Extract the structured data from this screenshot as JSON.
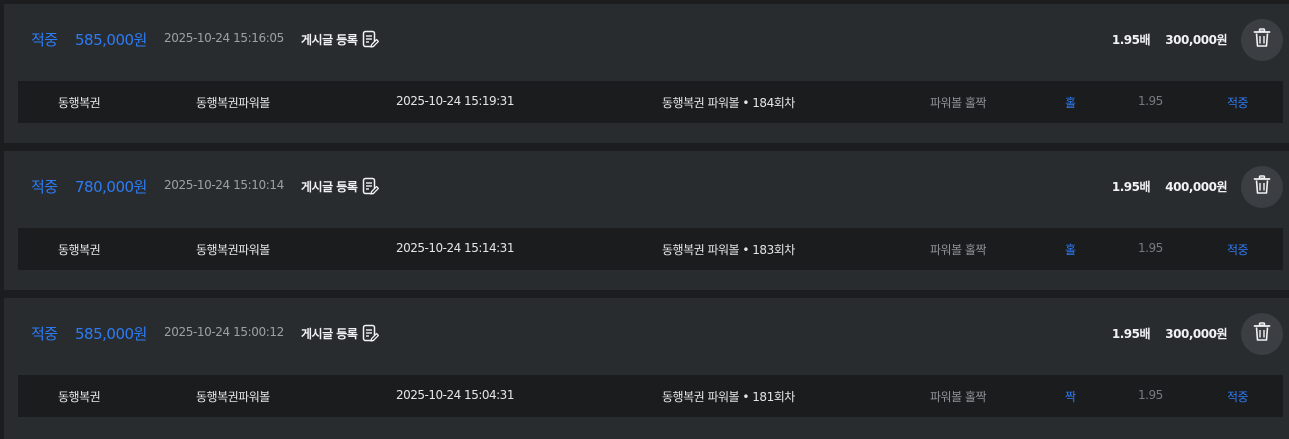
{
  "labels": {
    "post_button": "게시글 등록",
    "delete_icon": "trash-icon",
    "post_icon": "edit-note-icon"
  },
  "colors": {
    "accent": "#2d7bf4",
    "card_bg": "#292c2f",
    "row_bg": "#1b1c1e",
    "page_bg": "#1c1d1f"
  },
  "bets": [
    {
      "status": "적중",
      "win_amount": "585,000원",
      "bet_time": "2025-10-24 15:16:05",
      "total_odds": "1.95배",
      "bet_amount": "300,000원",
      "detail": {
        "company": "동행복권",
        "game": "동행복권파워볼",
        "draw_time": "2025-10-24 15:19:31",
        "round": "동행복권 파워볼 • 184회차",
        "market": "파워볼 홀짝",
        "pick": "홀",
        "odds": "1.95",
        "result": "적중"
      }
    },
    {
      "status": "적중",
      "win_amount": "780,000원",
      "bet_time": "2025-10-24 15:10:14",
      "total_odds": "1.95배",
      "bet_amount": "400,000원",
      "detail": {
        "company": "동행복권",
        "game": "동행복권파워볼",
        "draw_time": "2025-10-24 15:14:31",
        "round": "동행복권 파워볼 • 183회차",
        "market": "파워볼 홀짝",
        "pick": "홀",
        "odds": "1.95",
        "result": "적중"
      }
    },
    {
      "status": "적중",
      "win_amount": "585,000원",
      "bet_time": "2025-10-24 15:00:12",
      "total_odds": "1.95배",
      "bet_amount": "300,000원",
      "detail": {
        "company": "동행복권",
        "game": "동행복권파워볼",
        "draw_time": "2025-10-24 15:04:31",
        "round": "동행복권 파워볼 • 181회차",
        "market": "파워볼 홀짝",
        "pick": "짝",
        "odds": "1.95",
        "result": "적중"
      }
    }
  ]
}
